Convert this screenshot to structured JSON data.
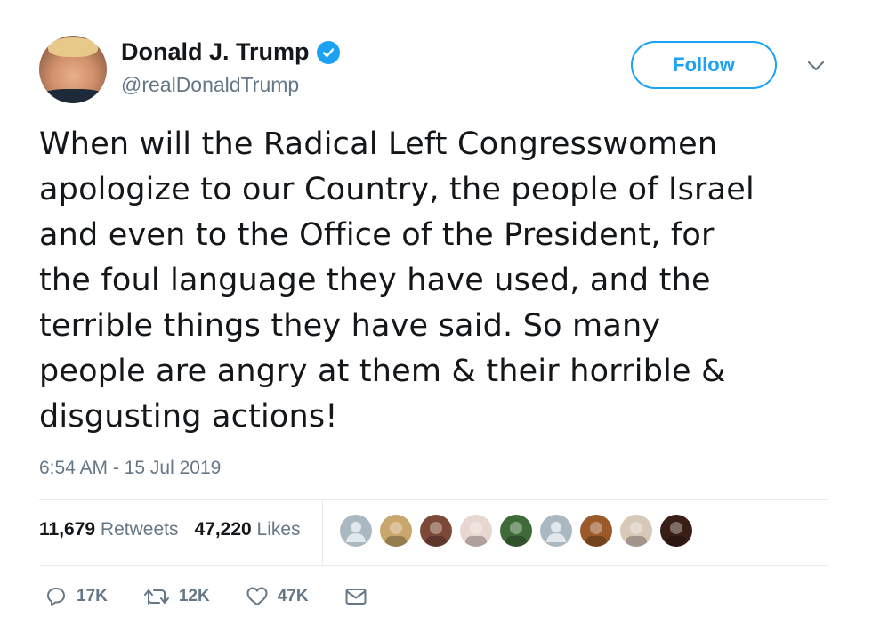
{
  "user": {
    "name": "Donald J. Trump",
    "handle": "@realDonaldTrump",
    "follow_label": "Follow"
  },
  "tweet": {
    "lines": [
      "When will the Radical Left Congresswomen",
      "apologize to our Country, the people of Israel",
      "and even to the Office of the President, for",
      "the foul language they have used, and the",
      "terrible things they have said. So many",
      "people are angry at them & their horrible &",
      "disgusting actions!"
    ],
    "timestamp": "6:54 AM - 15 Jul 2019"
  },
  "stats": {
    "retweets_count": "11,679",
    "retweets_label": "Retweets",
    "likes_count": "47,220",
    "likes_label": "Likes"
  },
  "likers": [
    {
      "icon": "default-avatar",
      "color": "#aab8c2"
    },
    {
      "icon": "photo-avatar",
      "color": "#c9a66b"
    },
    {
      "icon": "photo-avatar",
      "color": "#7d4a3a"
    },
    {
      "icon": "photo-avatar",
      "color": "#e8d6d0"
    },
    {
      "icon": "photo-avatar",
      "color": "#3f6b3a"
    },
    {
      "icon": "default-avatar",
      "color": "#aab8c2"
    },
    {
      "icon": "photo-avatar",
      "color": "#9a5a2a"
    },
    {
      "icon": "photo-avatar",
      "color": "#d8c8b8"
    },
    {
      "icon": "photo-avatar",
      "color": "#3a1f18"
    }
  ],
  "actions": {
    "replies": "17K",
    "retweets": "12K",
    "likes": "47K"
  },
  "colors": {
    "accent": "#1da1f2",
    "text": "#14171a",
    "secondary": "#657786"
  }
}
